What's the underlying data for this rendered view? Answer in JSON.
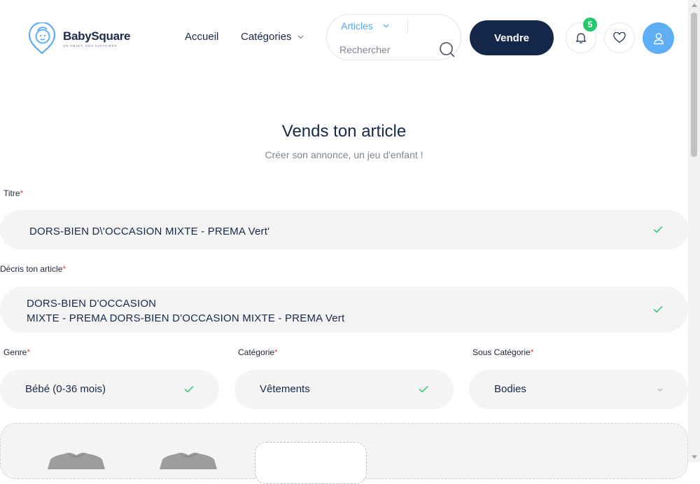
{
  "brand": {
    "name": "BabySquare",
    "tagline": "UN OBJET, DES HISTOIRES"
  },
  "nav": {
    "home": "Accueil",
    "categories": "Catégories"
  },
  "search": {
    "type": "Articles",
    "placeholder": "Rechercher"
  },
  "header": {
    "sell_label": "Vendre",
    "notifications_count": "5"
  },
  "page": {
    "title": "Vends ton article",
    "subtitle": "Créer son annonce, un jeu d'enfant !"
  },
  "form": {
    "title_label": "Titre",
    "title_value": "DORS-BIEN D\\'OCCASION MIXTE - PREMA Vert'",
    "desc_label": "Décris ton article",
    "desc_line1": "DORS-BIEN D'OCCASION",
    "desc_line2": "MIXTE - PREMA DORS-BIEN D'OCCASION MIXTE - PREMA Vert",
    "genre_label": "Genre",
    "genre_value": "Bébé (0-36 mois)",
    "category_label": "Catégorie",
    "category_value": "Vêtements",
    "subcategory_label": "Sous Catégorie",
    "subcategory_value": "Bodies",
    "required_mark": "*"
  },
  "colors": {
    "navy": "#16284a",
    "accent_blue": "#5aa6f3",
    "success": "#27c76f",
    "field_bg": "#f4f4f5"
  }
}
